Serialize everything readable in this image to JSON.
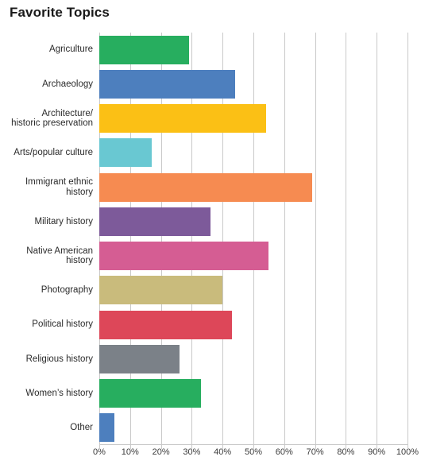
{
  "chart_data": {
    "type": "bar",
    "orientation": "horizontal",
    "title": "Favorite Topics",
    "xlabel": "",
    "ylabel": "",
    "xlim": [
      0,
      100
    ],
    "xtick_labels": [
      "0%",
      "10%",
      "20%",
      "30%",
      "40%",
      "50%",
      "60%",
      "70%",
      "80%",
      "90%",
      "100%"
    ],
    "xtick_values": [
      0,
      10,
      20,
      30,
      40,
      50,
      60,
      70,
      80,
      90,
      100
    ],
    "grid": true,
    "legend": "none",
    "categories": [
      "Agriculture",
      "Archaeology",
      "Architecture/ historic preservation",
      "Arts/popular culture",
      "Immigrant ethnic history",
      "Military history",
      "Native American history",
      "Photography",
      "Political history",
      "Religious history",
      "Women's history",
      "Other"
    ],
    "values": [
      29,
      44,
      54,
      17,
      69,
      36,
      55,
      40,
      43,
      26,
      33,
      5
    ],
    "colors": [
      "#27ae5f",
      "#4d7fbe",
      "#fbc015",
      "#69c8d2",
      "#f68b51",
      "#7d5a9a",
      "#d55d93",
      "#c9bb7c",
      "#dd4759",
      "#7b8188",
      "#27ae5f",
      "#4d7fbe"
    ]
  },
  "chart": {
    "title": "Favorite Topics",
    "bars": [
      {
        "label": "Agriculture",
        "label_lines": [
          "Agriculture"
        ],
        "value": 29,
        "color": "#27ae5f"
      },
      {
        "label": "Archaeology",
        "label_lines": [
          "Archaeology"
        ],
        "value": 44,
        "color": "#4d7fbe"
      },
      {
        "label": "Architecture/ historic preservation",
        "label_lines": [
          "Architecture/",
          "historic preservation"
        ],
        "value": 54,
        "color": "#fbc015"
      },
      {
        "label": "Arts/popular culture",
        "label_lines": [
          "Arts/popular culture"
        ],
        "value": 17,
        "color": "#69c8d2"
      },
      {
        "label": "Immigrant ethnic history",
        "label_lines": [
          "Immigrant ethnic",
          "history"
        ],
        "value": 69,
        "color": "#f68b51"
      },
      {
        "label": "Military history",
        "label_lines": [
          "Military history"
        ],
        "value": 36,
        "color": "#7d5a9a"
      },
      {
        "label": "Native American history",
        "label_lines": [
          "Native American",
          "history"
        ],
        "value": 55,
        "color": "#d55d93"
      },
      {
        "label": "Photography",
        "label_lines": [
          "Photography"
        ],
        "value": 40,
        "color": "#c9bb7c"
      },
      {
        "label": "Political history",
        "label_lines": [
          "Political history"
        ],
        "value": 43,
        "color": "#dd4759"
      },
      {
        "label": "Religious history",
        "label_lines": [
          "Religious history"
        ],
        "value": 26,
        "color": "#7b8188"
      },
      {
        "label": "Women's history",
        "label_lines": [
          "Women’s history"
        ],
        "value": 33,
        "color": "#27ae5f"
      },
      {
        "label": "Other",
        "label_lines": [
          "Other"
        ],
        "value": 5,
        "color": "#4d7fbe"
      }
    ]
  }
}
